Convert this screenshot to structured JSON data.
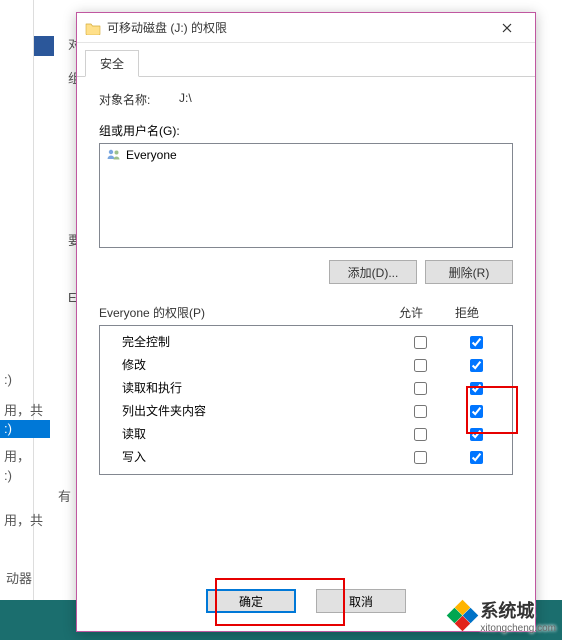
{
  "dialog": {
    "title": "可移动磁盘 (J:) 的权限",
    "tab_security": "安全",
    "object_name_label": "对象名称:",
    "object_name_value": "J:\\",
    "group_label": "组或用户名(G):",
    "principals": [
      {
        "name": "Everyone"
      }
    ],
    "add_btn": "添加(D)...",
    "remove_btn": "删除(R)",
    "perm_for_label": "Everyone 的权限(P)",
    "col_allow": "允许",
    "col_deny": "拒绝",
    "permissions": [
      {
        "name": "完全控制",
        "allow": false,
        "deny": true
      },
      {
        "name": "修改",
        "allow": false,
        "deny": true
      },
      {
        "name": "读取和执行",
        "allow": false,
        "deny": true
      },
      {
        "name": "列出文件夹内容",
        "allow": false,
        "deny": true
      },
      {
        "name": "读取",
        "allow": false,
        "deny": true
      },
      {
        "name": "写入",
        "allow": false,
        "deny": true
      }
    ],
    "ok_btn": "确定",
    "cancel_btn": "取消"
  },
  "background": {
    "t1": "对",
    "t2": "组",
    "t3": "要",
    "t4": "E",
    "t5": ":)",
    "t6": "用，共",
    "t7": ":)",
    "t8": "用，",
    "t9": ":)",
    "t10": "有",
    "t11": "用，共",
    "t12": "动器"
  },
  "watermark": {
    "main": "系统城",
    "sub": "xitongcheng.com"
  }
}
